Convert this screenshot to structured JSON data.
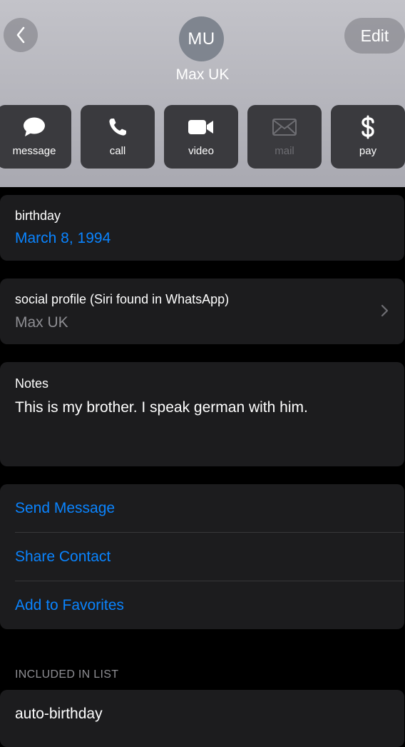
{
  "header": {
    "avatar_initials": "MU",
    "name": "Max UK",
    "edit_label": "Edit"
  },
  "actions": [
    {
      "label": "message",
      "icon": "message-bubble-icon",
      "enabled": true
    },
    {
      "label": "call",
      "icon": "phone-icon",
      "enabled": true
    },
    {
      "label": "video",
      "icon": "video-camera-icon",
      "enabled": true
    },
    {
      "label": "mail",
      "icon": "envelope-icon",
      "enabled": false
    },
    {
      "label": "pay",
      "icon": "dollar-icon",
      "enabled": true
    }
  ],
  "birthday": {
    "label": "birthday",
    "value": "March 8, 1994"
  },
  "social_profile": {
    "label": "social profile (Siri found in WhatsApp)",
    "value": "Max UK"
  },
  "notes": {
    "label": "Notes",
    "text": "This is my brother. I speak german with him."
  },
  "contact_actions": [
    {
      "label": "Send Message"
    },
    {
      "label": "Share Contact"
    },
    {
      "label": "Add to Favorites"
    }
  ],
  "lists": {
    "header": "INCLUDED IN LIST",
    "items": [
      {
        "label": "auto-birthday"
      }
    ]
  },
  "colors": {
    "accent": "#0a84ff",
    "card_bg": "#1c1c1e",
    "header_bg": "#b4b4bb"
  }
}
